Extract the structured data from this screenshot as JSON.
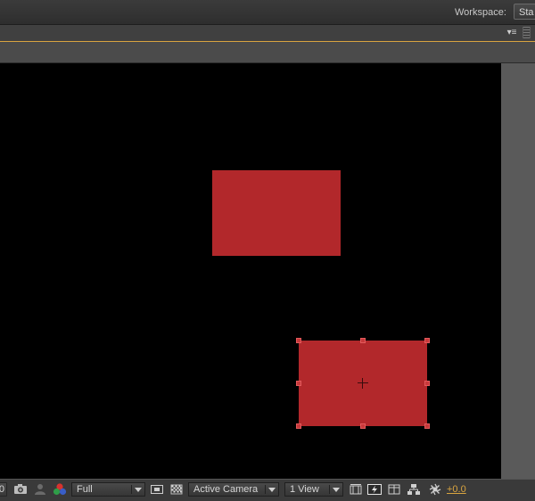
{
  "workspace": {
    "label": "Workspace:",
    "value": "Sta"
  },
  "panel": {
    "menu_icon": "panel-menu-icon",
    "grip_icon": "panel-grip-icon"
  },
  "statusbar": {
    "left_value": "0",
    "resolution": "Full",
    "camera": "Active Camera",
    "view_layout": "1 View",
    "exposure": "+0.0",
    "icons": [
      "snapshot-camera-icon",
      "show-snapshot-icon",
      "rgb-channels-icon",
      "region-of-interest-icon",
      "transparency-grid-icon",
      "toggle-mask-icon",
      "fast-previews-icon",
      "timeline-icon",
      "flowchart-icon",
      "reset-exposure-icon"
    ]
  },
  "colors": {
    "canvas": "#000000",
    "shape_fill": "#b2282b",
    "accent": "#d9a440"
  }
}
